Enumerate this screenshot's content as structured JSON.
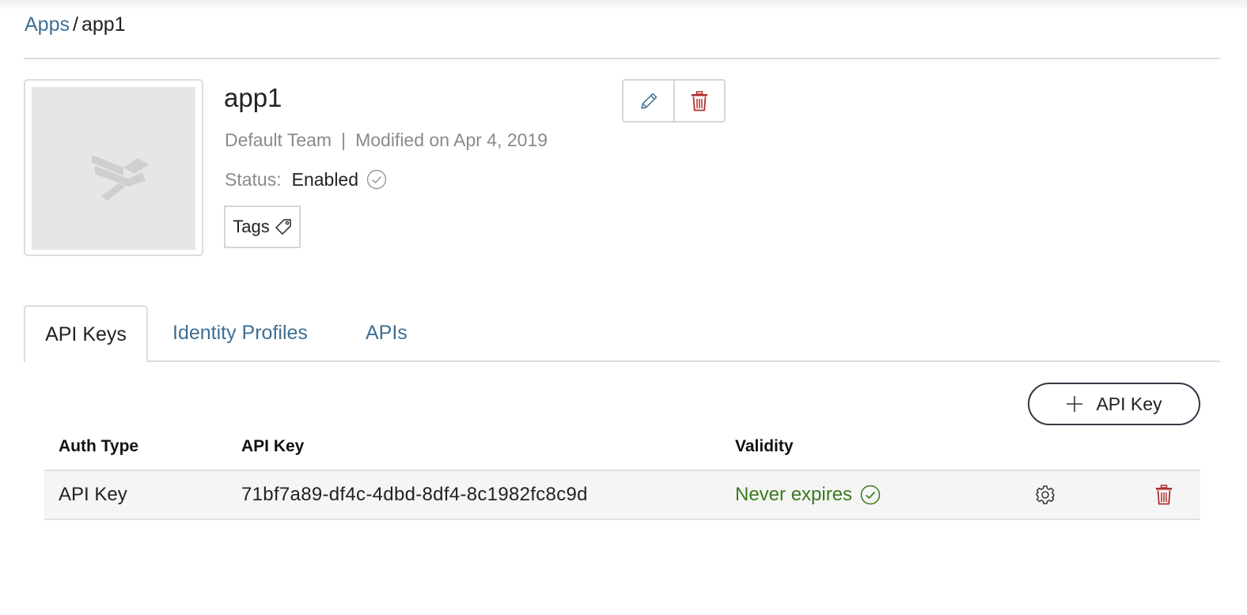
{
  "breadcrumb": {
    "parent": "Apps",
    "separator": "/",
    "current": "app1"
  },
  "app": {
    "name": "app1",
    "team": "Default Team",
    "modified": "Modified on Apr 4, 2019",
    "status_label": "Status:",
    "status_value": "Enabled",
    "tags_label": "Tags"
  },
  "tabs": [
    {
      "label": "API Keys",
      "active": true
    },
    {
      "label": "Identity Profiles",
      "active": false
    },
    {
      "label": "APIs",
      "active": false
    }
  ],
  "add_button_label": "API Key",
  "table": {
    "columns": [
      "Auth Type",
      "API Key",
      "Validity"
    ],
    "rows": [
      {
        "auth_type": "API Key",
        "api_key": "71bf7a89-df4c-4dbd-8df4-8c1982fc8c9d",
        "validity": "Never expires"
      }
    ]
  },
  "icons": {
    "edit": "pencil-icon",
    "delete": "trash-icon",
    "status": "check-circle-icon",
    "tag": "tag-icon",
    "add": "plus-icon",
    "settings": "gear-icon"
  },
  "colors": {
    "link": "#3f6f93",
    "danger": "#b0302d",
    "success": "#3c7a1e",
    "muted": "#8a8a8a"
  }
}
